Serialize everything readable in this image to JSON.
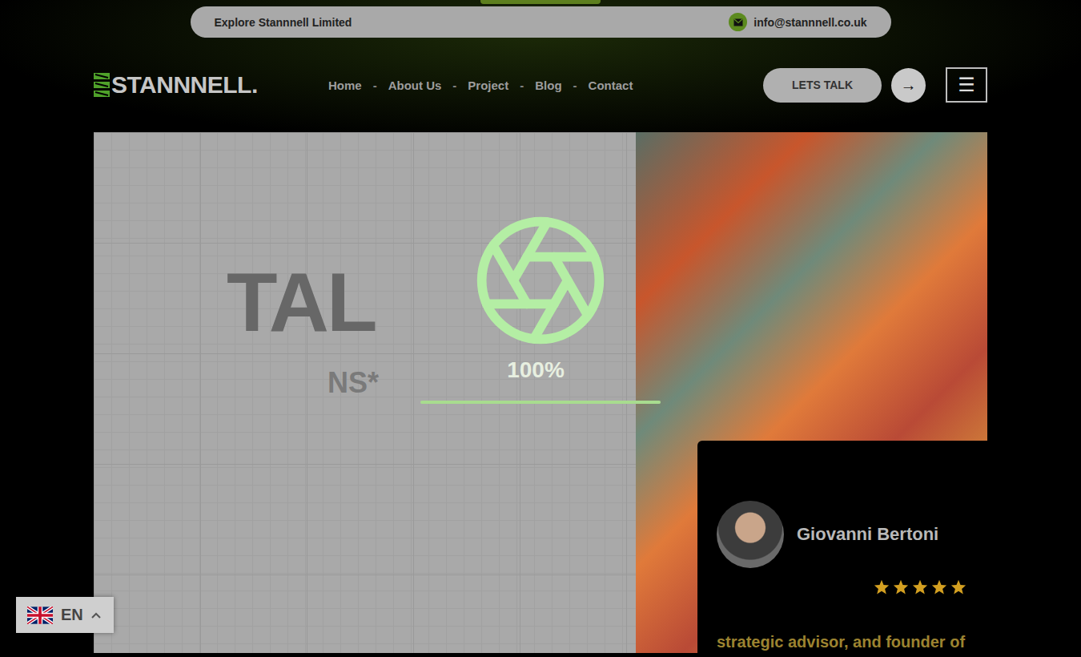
{
  "topbar": {
    "label": "Explore Stannnell Limited",
    "email": "info@stannnell.co.uk"
  },
  "logo": {
    "text": "STANNNELL."
  },
  "nav": {
    "separator": "-",
    "items": [
      {
        "label": "Home"
      },
      {
        "label": "About Us"
      },
      {
        "label": "Project"
      },
      {
        "label": "Blog"
      },
      {
        "label": "Contact"
      }
    ]
  },
  "header_actions": {
    "cta": "LETS TALK",
    "arrow": "→",
    "menu": "☰"
  },
  "hero": {
    "title": "TAL",
    "subtitle": "NS*"
  },
  "testimonial": {
    "name": "Giovanni Bertoni",
    "stars": 5,
    "text": "strategic advisor, and founder of"
  },
  "loader": {
    "percent": "100%",
    "level": 1
  },
  "language": {
    "code": "EN"
  }
}
